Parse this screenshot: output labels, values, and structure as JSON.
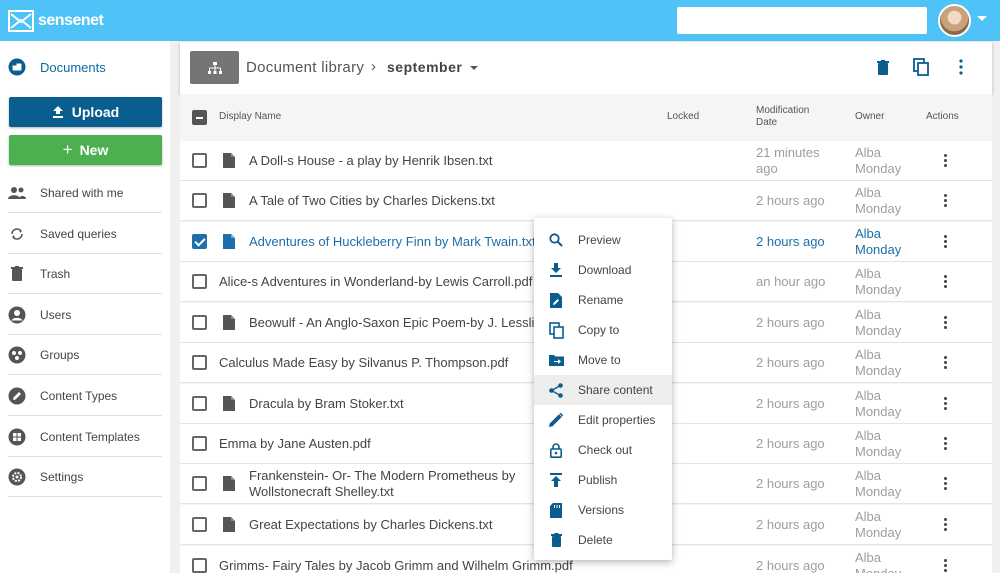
{
  "app": {
    "logo_text": "sensenet"
  },
  "sidebar": {
    "upload_label": "Upload",
    "new_label": "New",
    "items": [
      {
        "label": "Documents",
        "icon": "documents-icon"
      },
      {
        "label": "Shared with me",
        "icon": "people-icon"
      },
      {
        "label": "Saved queries",
        "icon": "sync-icon"
      },
      {
        "label": "Trash",
        "icon": "trash-icon"
      },
      {
        "label": "Users",
        "icon": "user-icon"
      },
      {
        "label": "Groups",
        "icon": "groups-icon"
      },
      {
        "label": "Content Types",
        "icon": "pencil-icon"
      },
      {
        "label": "Content Templates",
        "icon": "templates-icon"
      },
      {
        "label": "Settings",
        "icon": "gear-icon"
      }
    ]
  },
  "toolbar": {
    "breadcrumb_root": "Document library",
    "breadcrumb_sep": "›",
    "breadcrumb_current": "september"
  },
  "table": {
    "headers": {
      "name": "Display Name",
      "locked": "Locked",
      "modification": "Modification Date",
      "owner": "Owner",
      "actions": "Actions"
    },
    "rows": [
      {
        "name": "A Doll-s House - a play by Henrik Ibsen.txt",
        "modified": "21 minutes ago",
        "owner": "Alba Monday",
        "checked": false,
        "has_icon": true
      },
      {
        "name": "A Tale of Two Cities by Charles Dickens.txt",
        "modified": "2 hours ago",
        "owner": "Alba Monday",
        "checked": false,
        "has_icon": true
      },
      {
        "name": "Adventures of Huckleberry Finn by Mark Twain.txt",
        "modified": "2 hours ago",
        "owner": "Alba Monday",
        "checked": true,
        "has_icon": true
      },
      {
        "name": "Alice-s Adventures in Wonderland-by Lewis Carroll.pdf",
        "modified": "an hour ago",
        "owner": "Alba Monday",
        "checked": false,
        "has_icon": false
      },
      {
        "name": "Beowulf - An Anglo-Saxon Epic Poem-by J. Lesslie Hall.txt",
        "modified": "2 hours ago",
        "owner": "Alba Monday",
        "checked": false,
        "has_icon": true
      },
      {
        "name": "Calculus Made Easy by Silvanus P. Thompson.pdf",
        "modified": "2 hours ago",
        "owner": "Alba Monday",
        "checked": false,
        "has_icon": false
      },
      {
        "name": "Dracula by Bram Stoker.txt",
        "modified": "2 hours ago",
        "owner": "Alba Monday",
        "checked": false,
        "has_icon": true
      },
      {
        "name": "Emma by Jane Austen.pdf",
        "modified": "2 hours ago",
        "owner": "Alba Monday",
        "checked": false,
        "has_icon": false
      },
      {
        "name": "Frankenstein- Or- The Modern Prometheus by Mary Wollstonecraft Shelley.txt",
        "name_line1": "Frankenstein- Or- The Modern Prometheus by",
        "name_line2": "Wollstonecraft Shelley.txt",
        "modified": "2 hours ago",
        "owner": "Alba Monday",
        "checked": false,
        "has_icon": true
      },
      {
        "name": "Great Expectations by Charles Dickens.txt",
        "modified": "2 hours ago",
        "owner": "Alba Monday",
        "checked": false,
        "has_icon": true
      },
      {
        "name": "Grimms- Fairy Tales by Jacob Grimm and Wilhelm Grimm.pdf",
        "modified": "2 hours ago",
        "owner": "Alba Monday",
        "checked": false,
        "has_icon": false
      }
    ]
  },
  "context_menu": {
    "items": [
      {
        "label": "Preview",
        "icon": "search-icon"
      },
      {
        "label": "Download",
        "icon": "download-icon"
      },
      {
        "label": "Rename",
        "icon": "rename-icon"
      },
      {
        "label": "Copy to",
        "icon": "copy-icon"
      },
      {
        "label": "Move to",
        "icon": "move-icon"
      },
      {
        "label": "Share content",
        "icon": "share-icon"
      },
      {
        "label": "Edit properties",
        "icon": "edit-icon"
      },
      {
        "label": "Check out",
        "icon": "lock-icon"
      },
      {
        "label": "Publish",
        "icon": "publish-icon"
      },
      {
        "label": "Versions",
        "icon": "versions-icon"
      },
      {
        "label": "Delete",
        "icon": "delete-icon"
      }
    ],
    "hovered": "Share content"
  },
  "colors": {
    "topbar": "#4fc3f7",
    "primary": "#0a5d8f",
    "success": "#4caf50",
    "selected_text": "#1e6fa8",
    "icon_blue": "#0a5d8f"
  }
}
